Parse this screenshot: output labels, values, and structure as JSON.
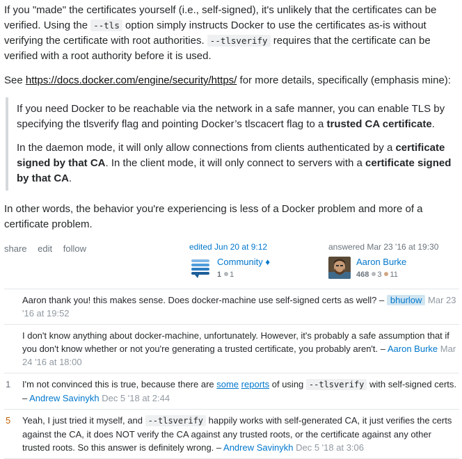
{
  "answer": {
    "p1": {
      "a": "If you \"made\" the certificates yourself (i.e., self-signed), it's unlikely that the certificates can be verified. Using the ",
      "code1": "--tls",
      "b": " option simply instructs Docker to use the certificates as-is without verifying the certificate with root authorities. ",
      "code2": "--tlsverify",
      "c": " requires that the certificate can be verified with a root authority before it is used."
    },
    "p2": {
      "a": "See ",
      "link": "https://docs.docker.com/engine/security/https/",
      "b": " for more details, specifically (emphasis mine):"
    },
    "quote": {
      "q1a": "If you need Docker to be reachable via the network in a safe manner, you can enable TLS by specifying the tlsverify flag and pointing Docker’s tlscacert flag to a ",
      "q1bold": "trusted CA certificate",
      "q1b": ".",
      "q2a": "In the daemon mode, it will only allow connections from clients authenticated by a ",
      "q2bold1": "certificate signed by that CA",
      "q2b": ". In the client mode, it will only connect to servers with a ",
      "q2bold2": "certificate signed by that CA",
      "q2c": "."
    },
    "p3": "In other words, the behavior you're experiencing is less of a Docker problem and more of a certificate problem."
  },
  "post_menu": {
    "share": "share",
    "edit": "edit",
    "follow": "follow"
  },
  "edited": {
    "action": "edited Jun 20 at 9:12",
    "user": "Community",
    "diamond": "♦",
    "rep": "1",
    "silver": "1"
  },
  "answered": {
    "action": "answered Mar 23 '16 at 19:30",
    "user": "Aaron Burke",
    "rep": "468",
    "silver": "3",
    "bronze": "11"
  },
  "comments": [
    {
      "score": "",
      "text": "Aaron thank you! this makes sense. Does docker-machine use self-signed certs as well? – ",
      "user": "bhurlow",
      "date": "Mar 23 '16 at 19:52"
    },
    {
      "score": "",
      "text": "I don't know anything about docker-machine, unfortunately. However, it's probably a safe assumption that if you don't know whether or not you're generating a trusted certificate, you probably aren't. – ",
      "user": "Aaron Burke",
      "date": "Mar 24 '16 at 18:00"
    },
    {
      "score": "1",
      "a": "I'm not convinced this is true, because there are ",
      "link1": "some",
      "link2": "reports",
      "b": " of using ",
      "code": "--tlsverify",
      "c": " with self-signed certs. – ",
      "user": "Andrew Savinykh",
      "date": "Dec 5 '18 at 2:44"
    },
    {
      "score": "5",
      "a": "Yeah, I just tried it myself, and ",
      "code": "--tlsverify",
      "b": " happily works with self-generated CA, it just verifies the certs against the CA, it does NOT verify the CA against any trusted roots, or the certificate against any other trusted roots. So this answer is definitely wrong. – ",
      "user": "Andrew Savinykh",
      "date": "Dec 5 '18 at 3:06"
    }
  ],
  "colors": {
    "link": "#0077cc",
    "quote_border": "#d6d9dc",
    "code_bg": "#eff0f1",
    "score_hot": "#c35e00"
  }
}
